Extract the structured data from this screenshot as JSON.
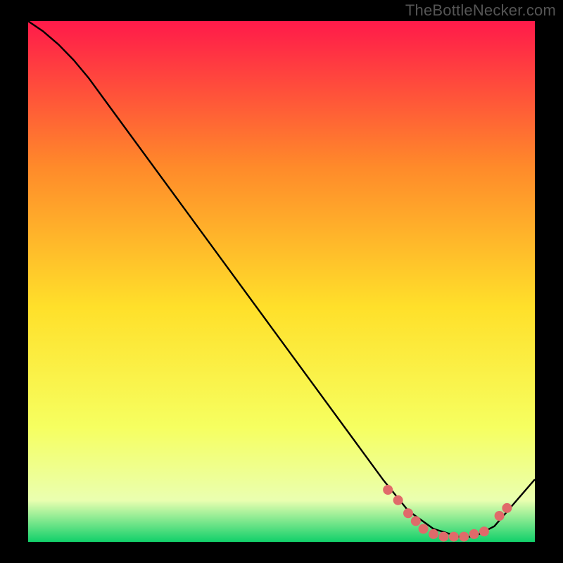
{
  "watermark": "TheBottleNecker.com",
  "chart_data": {
    "type": "line",
    "title": "",
    "xlabel": "",
    "ylabel": "",
    "xlim": [
      0,
      100
    ],
    "ylim": [
      0,
      100
    ],
    "gradient_background": {
      "top": "#ff1a4a",
      "mid_upper": "#ff8a2a",
      "mid": "#ffe02a",
      "mid_lower": "#f6ff60",
      "low": "#eaffb0",
      "bottom": "#11d06a"
    },
    "series": [
      {
        "name": "bottleneck-curve",
        "color": "#000000",
        "x": [
          0,
          3,
          6,
          9,
          12,
          15,
          70,
          75,
          80,
          85,
          88,
          92,
          100
        ],
        "y": [
          100,
          98,
          95.5,
          92.5,
          89,
          85,
          12,
          6,
          2.5,
          1,
          1,
          3,
          12
        ]
      }
    ],
    "markers": {
      "name": "marker-dots",
      "color": "#e06a6a",
      "radius": 7,
      "points": [
        {
          "x": 71,
          "y": 10
        },
        {
          "x": 73,
          "y": 8
        },
        {
          "x": 75,
          "y": 5.5
        },
        {
          "x": 76.5,
          "y": 4
        },
        {
          "x": 78,
          "y": 2.5
        },
        {
          "x": 80,
          "y": 1.5
        },
        {
          "x": 82,
          "y": 1
        },
        {
          "x": 84,
          "y": 1
        },
        {
          "x": 86,
          "y": 1
        },
        {
          "x": 88,
          "y": 1.5
        },
        {
          "x": 90,
          "y": 2
        },
        {
          "x": 93,
          "y": 5
        },
        {
          "x": 94.5,
          "y": 6.5
        }
      ]
    }
  }
}
